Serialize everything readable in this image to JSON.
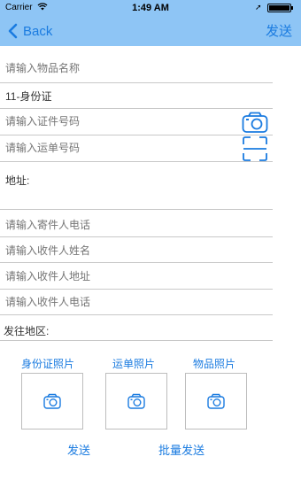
{
  "status_bar": {
    "carrier": "Carrier",
    "time": "1:49 AM"
  },
  "nav": {
    "back_label": "Back",
    "send_label": "发送"
  },
  "form": {
    "item_name_placeholder": "请输入物品名称",
    "id_type_value": "11-身份证",
    "id_number_placeholder": "请输入证件号码",
    "waybill_placeholder": "请输入运单号码",
    "address_label": "地址:",
    "sender_phone_placeholder": "请输入寄件人电话",
    "receiver_name_placeholder": "请输入收件人姓名",
    "receiver_address_placeholder": "请输入收件人地址",
    "receiver_phone_placeholder": "请输入收件人电话",
    "region_label": "发往地区:"
  },
  "photos": [
    {
      "label": "身份证照片"
    },
    {
      "label": "运单照片"
    },
    {
      "label": "物品照片"
    }
  ],
  "actions": {
    "send_label": "发送",
    "batch_send_label": "批量发送"
  },
  "colors": {
    "nav_background": "#8ec5f5",
    "accent": "#1a7be0"
  },
  "icons": [
    "wifi-icon",
    "location-arrow-icon",
    "battery-icon",
    "chevron-left-icon",
    "camera-icon",
    "scan-icon"
  ]
}
